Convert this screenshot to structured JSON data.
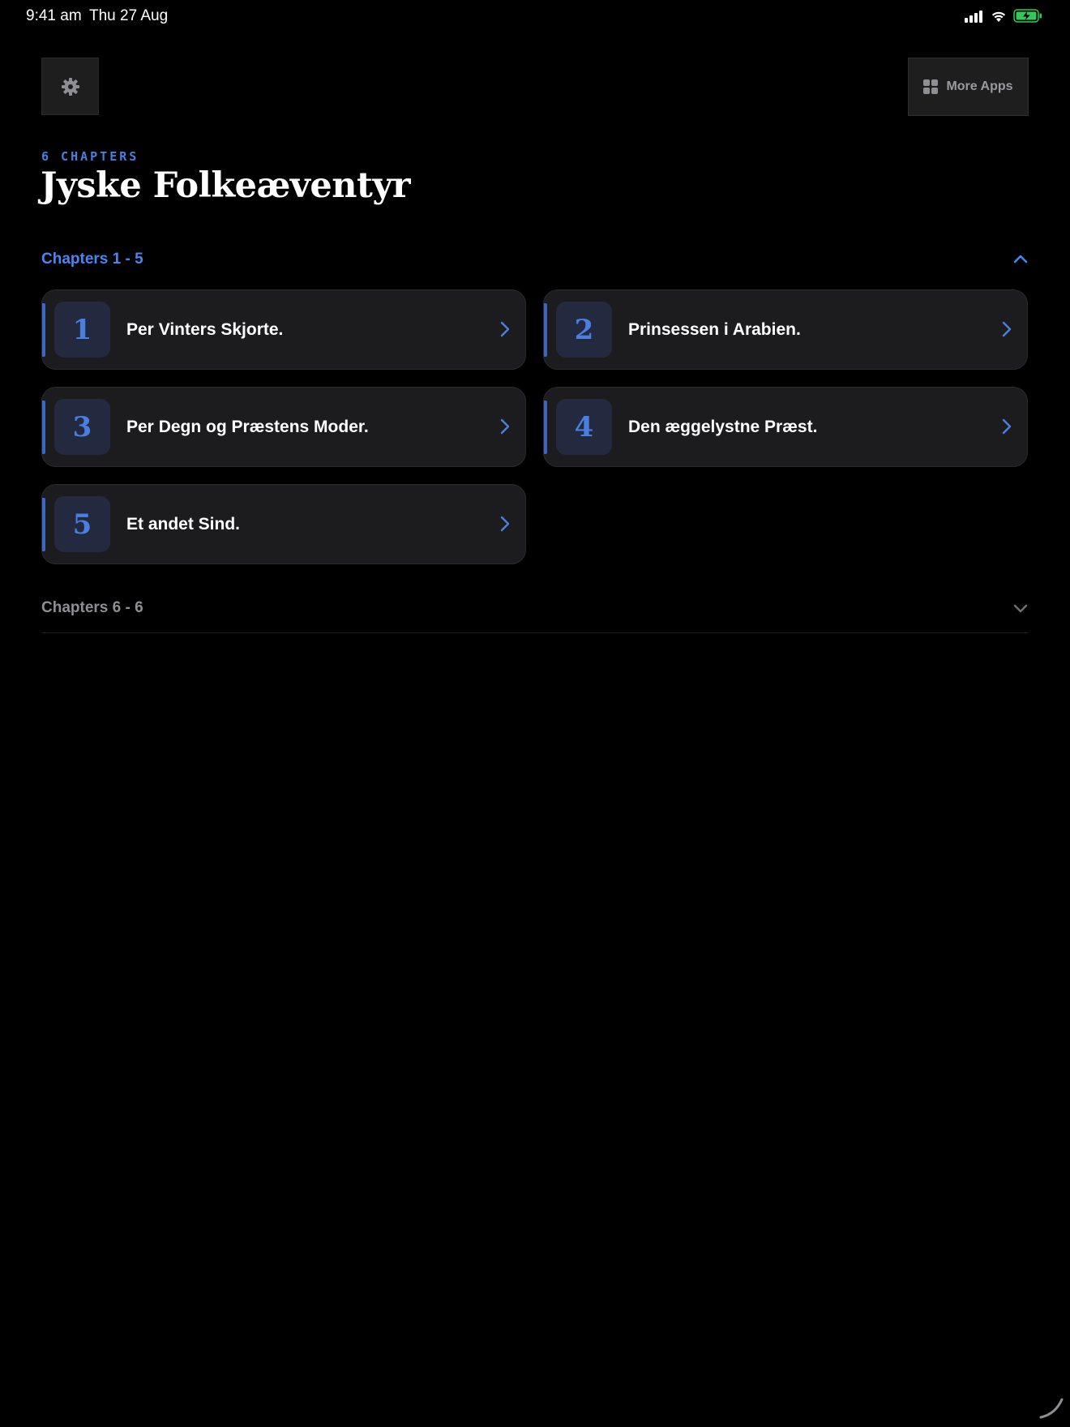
{
  "status_bar": {
    "time": "9:41 am",
    "date": "Thu 27 Aug"
  },
  "toolbar": {
    "settings_icon": "gear-icon",
    "more_apps_label": "More Apps",
    "more_apps_icon": "grid-icon"
  },
  "header": {
    "chapter_count": "6 CHAPTERS",
    "title": "Jyske Folkeæventyr"
  },
  "sections": [
    {
      "label": "Chapters 1 - 5",
      "expanded": true,
      "chapters": [
        {
          "number": "1",
          "title": "Per Vinters Skjorte."
        },
        {
          "number": "2",
          "title": "Prinsessen i Arabien."
        },
        {
          "number": "3",
          "title": "Per Degn og Præstens Moder."
        },
        {
          "number": "4",
          "title": "Den æggelystne Præst."
        },
        {
          "number": "5",
          "title": "Et andet Sind."
        }
      ]
    },
    {
      "label": "Chapters 6 - 6",
      "expanded": false
    }
  ],
  "colors": {
    "accent": "#4a7fe0",
    "background": "#000000",
    "card": "#1c1c1e",
    "battery": "#34c759"
  }
}
